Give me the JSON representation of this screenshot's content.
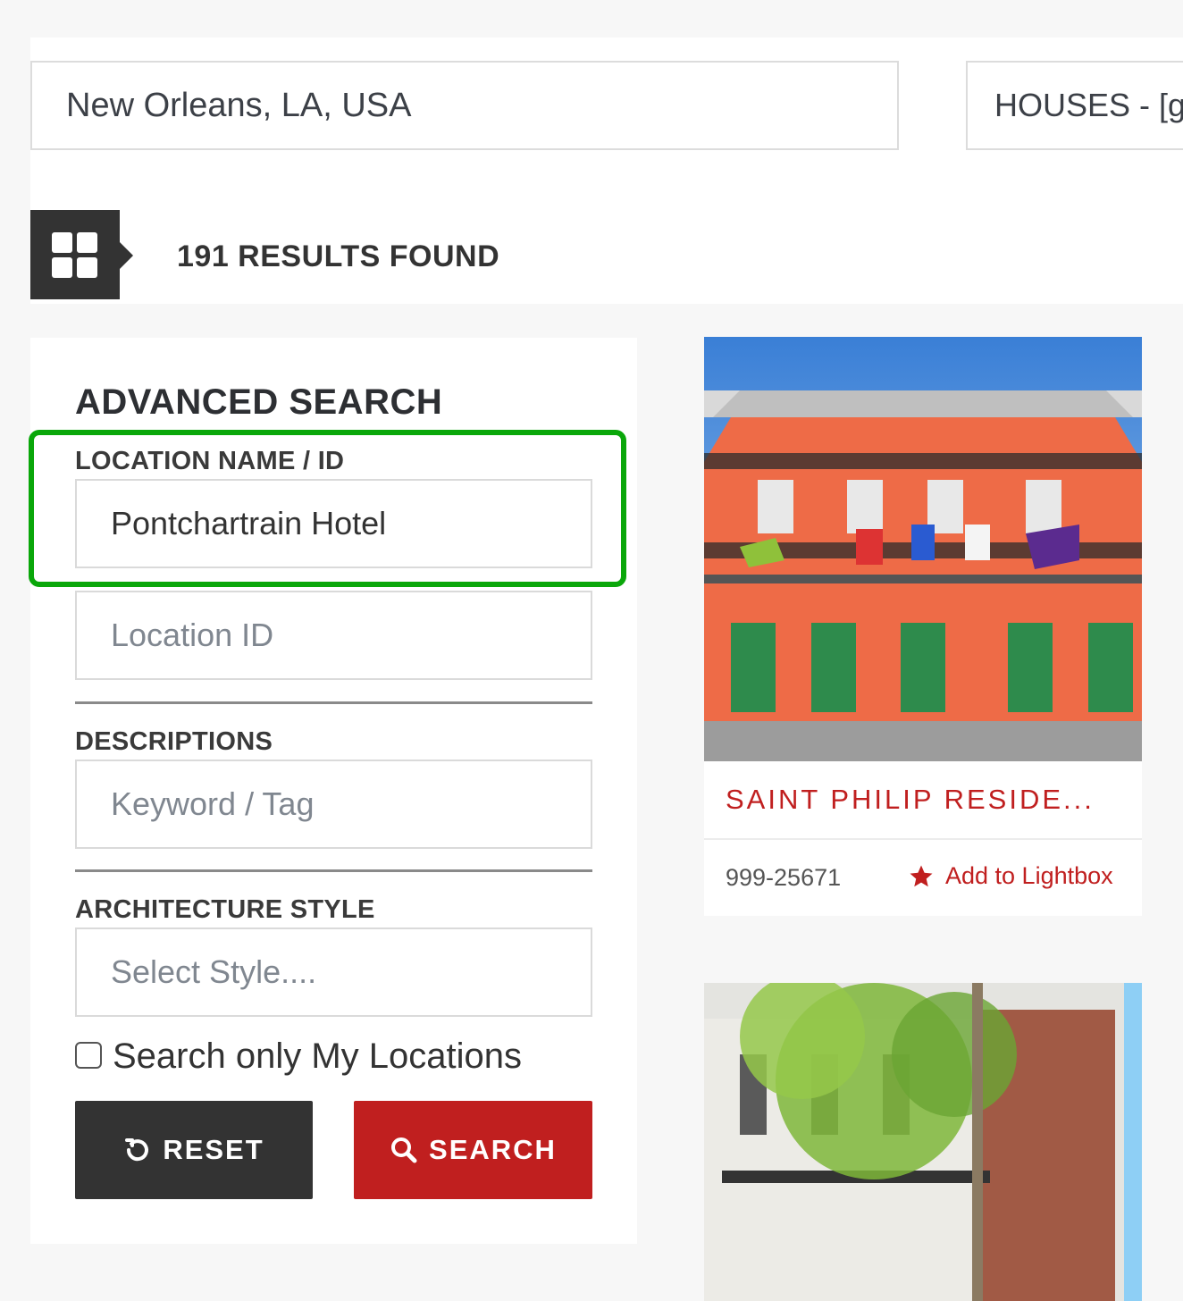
{
  "search": {
    "location_value": "New Orleans, LA, USA",
    "category_value": "HOUSES - [g"
  },
  "results": {
    "count_text": "191 RESULTS FOUND"
  },
  "advanced_search": {
    "title": "ADVANCED SEARCH",
    "location_label": "LOCATION NAME / ID",
    "location_name_value": "Pontchartrain Hotel",
    "location_id_placeholder": "Location ID",
    "descriptions_label": "DESCRIPTIONS",
    "keyword_placeholder": "Keyword / Tag",
    "architecture_label": "ARCHITECTURE STYLE",
    "style_placeholder": "Select Style....",
    "my_locations_label": "Search only My Locations",
    "reset_label": "RESET",
    "search_label": "SEARCH"
  },
  "cards": [
    {
      "title": "SAINT PHILIP RESIDE...",
      "id": "999-25671",
      "lightbox_label": "Add to Lightbox"
    }
  ],
  "colors": {
    "accent_red": "#c01f1f",
    "dark": "#333333",
    "highlight_green": "#0aa70a"
  },
  "icons": [
    "grid-view-icon",
    "reset-icon",
    "search-icon",
    "star-icon"
  ]
}
